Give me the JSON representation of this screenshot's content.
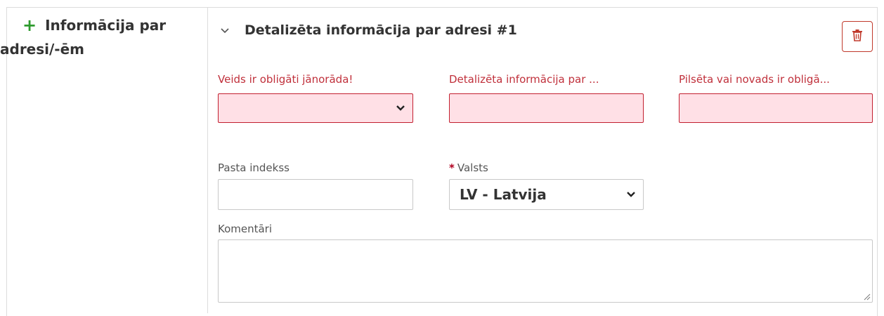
{
  "sidebar": {
    "title": "Informācija par adresi/-ēm",
    "add_icon": "plus-icon"
  },
  "section": {
    "title": "Detalizēta informācija par adresi #1",
    "collapse_icon": "chevron-down-icon",
    "delete_icon": "trash-icon"
  },
  "form": {
    "type": {
      "label": "Veids ir obligāti jānorāda!",
      "value": ""
    },
    "detail": {
      "label": "Detalizēta informācija par ...",
      "value": ""
    },
    "city": {
      "label": "Pilsēta vai novads ir obligā...",
      "value": ""
    },
    "postal": {
      "label": "Pasta indekss",
      "value": ""
    },
    "country": {
      "required_mark": "*",
      "label": "Valsts",
      "value": "LV - Latvija"
    },
    "comments": {
      "label": "Komentāri",
      "value": ""
    }
  },
  "colors": {
    "error_text": "#c0303b",
    "error_bg": "#ffe0e6",
    "add_green": "#2e9b2e",
    "delete_red": "#c0392b"
  }
}
